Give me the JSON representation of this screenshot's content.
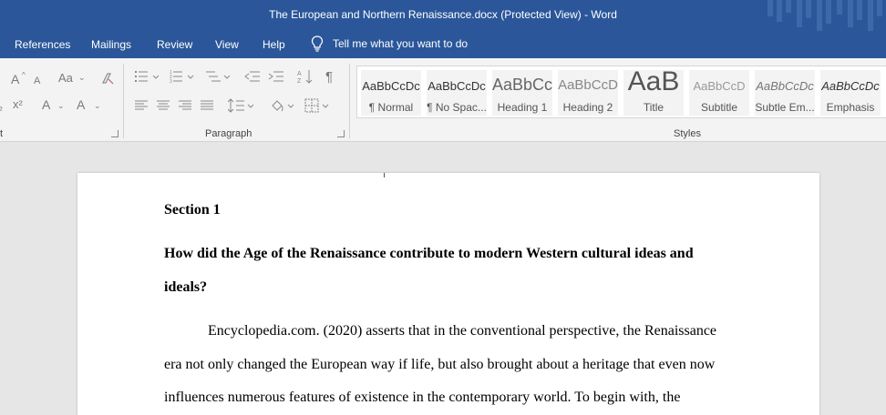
{
  "window": {
    "title": "The European and Northern Renaissance.docx (Protected View)  -  Word",
    "accent_color": "#2b579a"
  },
  "menu": {
    "tabs": [
      "References",
      "Mailings",
      "Review",
      "View",
      "Help"
    ],
    "tell_me": "Tell me what you want to do"
  },
  "ribbon": {
    "groups": {
      "font_partial": "t",
      "paragraph": "Paragraph",
      "styles": "Styles"
    },
    "font_icons": {
      "grow": "A",
      "shrink": "A",
      "case": "Aa",
      "superscript": "x²",
      "highlight": "A",
      "color": "A"
    },
    "styles": [
      {
        "sample": "AaBbCcDc",
        "name": "¶ Normal"
      },
      {
        "sample": "AaBbCcDc",
        "name": "¶ No Spac..."
      },
      {
        "sample": "AaBbCc",
        "name": "Heading 1"
      },
      {
        "sample": "AaBbCcD",
        "name": "Heading 2"
      },
      {
        "sample": "AaB",
        "name": "Title"
      },
      {
        "sample": "AaBbCcD",
        "name": "Subtitle"
      },
      {
        "sample": "AaBbCcDc",
        "name": "Subtle Em..."
      },
      {
        "sample": "AaBbCcDc",
        "name": "Emphasis"
      }
    ]
  },
  "document": {
    "heading": "Section 1",
    "question_line1": "How did the Age of the Renaissance contribute to modern Western cultural ideas and",
    "question_line2": "ideals?",
    "body_lines": [
      "Encyclopedia.com. (2020) asserts that in the conventional perspective, the Renaissance",
      "era not only changed the European way if life, but also brought about a heritage that even now",
      "influences numerous features of existence in the contemporary world. To begin with, the"
    ]
  }
}
